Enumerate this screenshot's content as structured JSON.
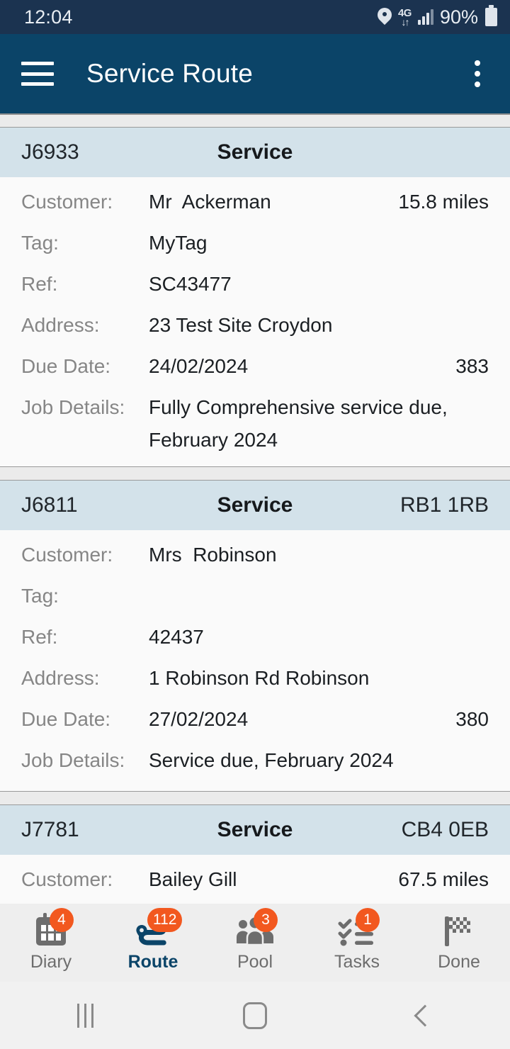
{
  "status_bar": {
    "time": "12:04",
    "battery_percent": "90%",
    "network_type": "4G",
    "icons": [
      "location-pin-icon",
      "mobile-data-icon",
      "signal-bars-icon",
      "battery-icon"
    ]
  },
  "app_bar": {
    "title": "Service Route",
    "menu_icon": "hamburger-menu-icon",
    "overflow_icon": "overflow-menu-icon"
  },
  "labels": {
    "customer": "Customer:",
    "tag": "Tag:",
    "ref": "Ref:",
    "address": "Address:",
    "due_date": "Due Date:",
    "job_details": "Job Details:"
  },
  "jobs": [
    {
      "job_id": "J6933",
      "job_type": "Service",
      "postcode": "",
      "customer": "Mr  Ackerman",
      "distance": "15.8 miles",
      "tag": "MyTag",
      "ref": "SC43477",
      "address": "23 Test Site Croydon",
      "due_date": "24/02/2024",
      "due_number": "383",
      "job_details": "Fully Comprehensive service due,\nFebruary 2024"
    },
    {
      "job_id": "J6811",
      "job_type": "Service",
      "postcode": "RB1 1RB",
      "customer": "Mrs  Robinson",
      "distance": "",
      "tag": "",
      "ref": "42437",
      "address": "1 Robinson Rd Robinson",
      "due_date": "27/02/2024",
      "due_number": "380",
      "job_details": "Service due, February 2024"
    },
    {
      "job_id": "J7781",
      "job_type": "Service",
      "postcode": "CB4 0EB",
      "customer": "Bailey Gill",
      "distance": "67.5 miles",
      "tag": "",
      "ref": "",
      "address": "",
      "due_date": "",
      "due_number": "",
      "job_details": ""
    }
  ],
  "bottom_nav": {
    "items": [
      {
        "label": "Diary",
        "badge": "4",
        "icon": "calendar-icon",
        "active": false
      },
      {
        "label": "Route",
        "badge": "112",
        "icon": "route-pin-icon",
        "active": true
      },
      {
        "label": "Pool",
        "badge": "3",
        "icon": "people-group-icon",
        "active": false
      },
      {
        "label": "Tasks",
        "badge": "1",
        "icon": "checklist-icon",
        "active": false
      },
      {
        "label": "Done",
        "badge": "",
        "icon": "checkered-flag-icon",
        "active": false
      }
    ]
  },
  "system_nav": {
    "recents": "recents-icon",
    "home": "home-icon",
    "back": "back-icon"
  },
  "colors": {
    "status_bar": "#1b3350",
    "app_bar": "#0b4468",
    "card_header": "#d3e2ea",
    "badge": "#f2581f",
    "accent": "#0b4468"
  }
}
